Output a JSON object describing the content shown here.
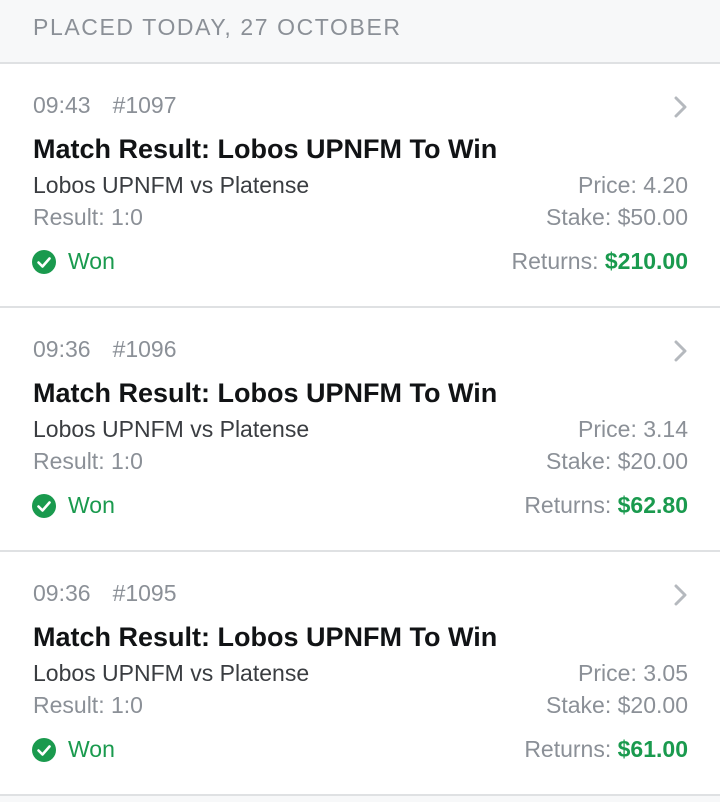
{
  "section": {
    "header": "PLACED TODAY, 27 OCTOBER"
  },
  "labels": {
    "price": "Price:",
    "stake": "Stake:",
    "returns": "Returns:"
  },
  "colors": {
    "won_green": "#1a9a4e",
    "muted_text": "#8b9097",
    "divider": "#dfe1e3"
  },
  "icons": {
    "status": "check-circle-icon",
    "open": "chevron-right-icon"
  },
  "bets": [
    {
      "time": "09:43",
      "id": "#1097",
      "title": "Match Result: Lobos UPNFM To Win",
      "fixture": "Lobos UPNFM vs Platense",
      "result": "Result: 1:0",
      "status": "Won",
      "price": "4.20",
      "stake": "$50.00",
      "returns": "$210.00"
    },
    {
      "time": "09:36",
      "id": "#1096",
      "title": "Match Result: Lobos UPNFM To Win",
      "fixture": "Lobos UPNFM vs Platense",
      "result": "Result: 1:0",
      "status": "Won",
      "price": "3.14",
      "stake": "$20.00",
      "returns": "$62.80"
    },
    {
      "time": "09:36",
      "id": "#1095",
      "title": "Match Result: Lobos UPNFM To Win",
      "fixture": "Lobos UPNFM vs Platense",
      "result": "Result: 1:0",
      "status": "Won",
      "price": "3.05",
      "stake": "$20.00",
      "returns": "$61.00"
    }
  ]
}
